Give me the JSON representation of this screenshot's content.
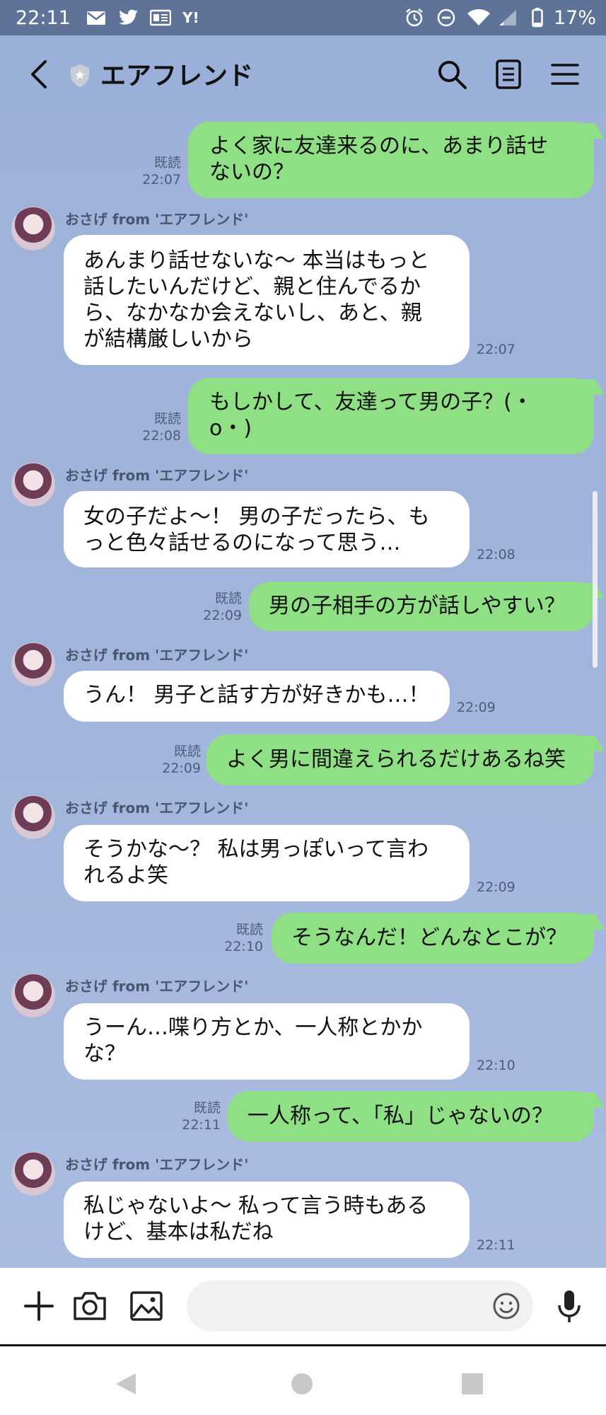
{
  "status_bar": {
    "time": "22:11",
    "battery": "17%",
    "notif_icons": [
      "mail-icon",
      "twitter-icon",
      "news-icon",
      "yahoo-icon"
    ],
    "sys_icons": [
      "alarm-icon",
      "dnd-icon",
      "wifi-icon",
      "signal-icon",
      "battery-icon"
    ]
  },
  "header": {
    "title": "エアフレンド"
  },
  "messages": [
    {
      "dir": "out",
      "text": "よく家に友達来るのに、あまり話せ\nないの？",
      "read": "既読",
      "time": "22:07"
    },
    {
      "dir": "in",
      "sender": "おさげ from 'エアフレンド'",
      "text": "あんまり話せないな〜 本当はもっと\n話したいんだけど、親と住んでるか\nら、なかなか会えないし、あと、親\nが結構厳しいから",
      "time": "22:07"
    },
    {
      "dir": "out",
      "text": "もしかして、友達って男の子？(・\no・)",
      "read": "既読",
      "time": "22:08"
    },
    {
      "dir": "in",
      "sender": "おさげ from 'エアフレンド'",
      "text": "女の子だよ〜！ 男の子だったら、も\nっと色々話せるのになって思う…",
      "time": "22:08"
    },
    {
      "dir": "out",
      "text": "男の子相手の方が話しやすい？",
      "read": "既読",
      "time": "22:09"
    },
    {
      "dir": "in",
      "sender": "おさげ from 'エアフレンド'",
      "text": "うん！ 男子と話す方が好きかも…！",
      "time": "22:09"
    },
    {
      "dir": "out",
      "text": "よく男に間違えられるだけあるね笑",
      "read": "既読",
      "time": "22:09"
    },
    {
      "dir": "in",
      "sender": "おさげ from 'エアフレンド'",
      "text": "そうかな〜？ 私は男っぽいって言わ\nれるよ笑",
      "time": "22:09"
    },
    {
      "dir": "out",
      "text": "そうなんだ！どんなとこが？",
      "read": "既読",
      "time": "22:10"
    },
    {
      "dir": "in",
      "sender": "おさげ from 'エアフレンド'",
      "text": "うーん…喋り方とか、一人称とかか\nな？",
      "time": "22:10"
    },
    {
      "dir": "out",
      "text": "一人称って、「私」じゃないの？",
      "read": "既読",
      "time": "22:11"
    },
    {
      "dir": "in",
      "sender": "おさげ from 'エアフレンド'",
      "text": "私じゃないよ〜 私って言う時もある\nけど、基本は私だね",
      "time": "22:11"
    }
  ],
  "input": {
    "placeholder": ""
  },
  "colors": {
    "out_bubble": "#8fe085",
    "in_bubble": "#ffffff",
    "chat_bg": "#9bb0d8",
    "status_bar": "#5f7398"
  }
}
